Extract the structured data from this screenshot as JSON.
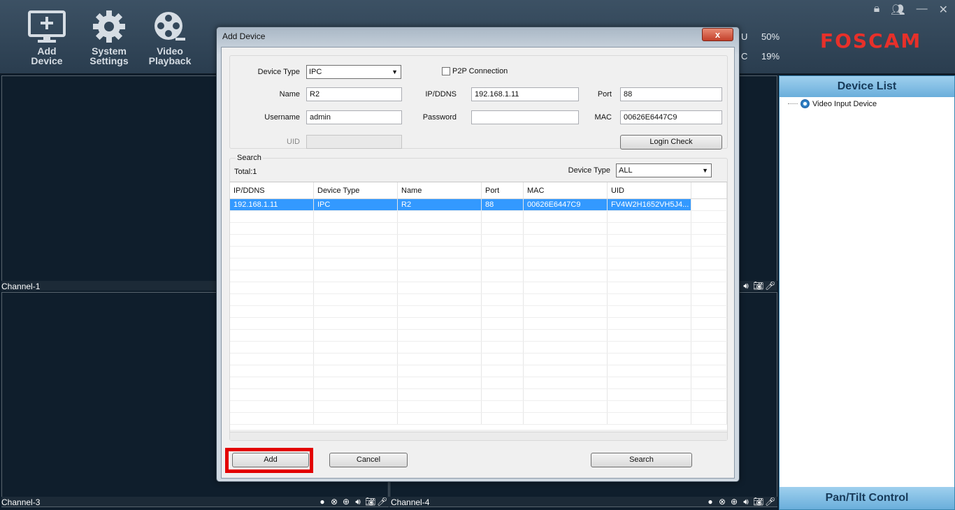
{
  "toolbar": {
    "add_device": [
      "Add",
      "Device"
    ],
    "system_settings": [
      "System",
      "Settings"
    ],
    "video_playback": [
      "Video",
      "Playback"
    ],
    "cpu_label": "U",
    "cpu_value": "50%",
    "mem_label": "C",
    "mem_value": "19%",
    "logo": "FOSCAM"
  },
  "channels": {
    "ch1": "Channel-1",
    "ch3": "Channel-3",
    "ch4": "Channel-4"
  },
  "right_panel": {
    "title": "Device List",
    "tree_item": "Video Input Device",
    "bottom_title": "Pan/Tilt Control"
  },
  "dialog": {
    "title": "Add Device",
    "close_label": "x",
    "labels": {
      "device_type": "Device Type",
      "name": "Name",
      "username": "Username",
      "uid": "UID",
      "ip_ddns": "IP/DDNS",
      "password": "Password",
      "port": "Port",
      "mac": "MAC",
      "p2p": "P2P Connection"
    },
    "values": {
      "device_type": "IPC",
      "name": "R2",
      "username": "admin",
      "uid": "",
      "ip_ddns": "192.168.1.11",
      "password": "",
      "port": "88",
      "mac": "00626E6447C9"
    },
    "login_check": "Login Check",
    "search": {
      "legend": "Search",
      "total": "Total:1",
      "device_type_label": "Device Type",
      "device_type_value": "ALL",
      "columns": [
        "IP/DDNS",
        "Device Type",
        "Name",
        "Port",
        "MAC",
        "UID"
      ],
      "rows": [
        [
          "192.168.1.11",
          "IPC",
          "R2",
          "88",
          "00626E6447C9",
          "FV4W2H1652VH5J4..."
        ]
      ]
    },
    "buttons": {
      "add": "Add",
      "cancel": "Cancel",
      "search": "Search"
    }
  }
}
